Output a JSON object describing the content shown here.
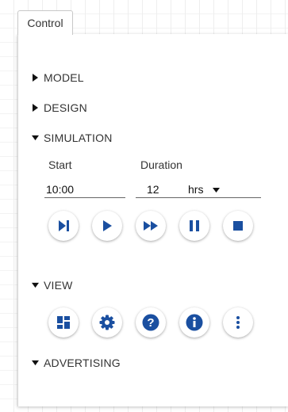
{
  "tab": {
    "label": "Control"
  },
  "sections": {
    "model": "MODEL",
    "design": "DESIGN",
    "simulation": "SIMULATION",
    "view": "VIEW",
    "advertising": "ADVERTISING"
  },
  "simulation": {
    "start_label": "Start",
    "start_value": "10:00",
    "duration_label": "Duration",
    "duration_value": "12",
    "duration_unit": "hrs"
  },
  "colors": {
    "accent": "#1a4fa0",
    "text": "#333333"
  },
  "icons": {
    "playback": [
      "step-forward-icon",
      "play-icon",
      "fast-forward-icon",
      "pause-icon",
      "stop-icon"
    ],
    "view": [
      "dashboard-icon",
      "gear-icon",
      "help-icon",
      "info-icon",
      "more-vert-icon"
    ]
  }
}
